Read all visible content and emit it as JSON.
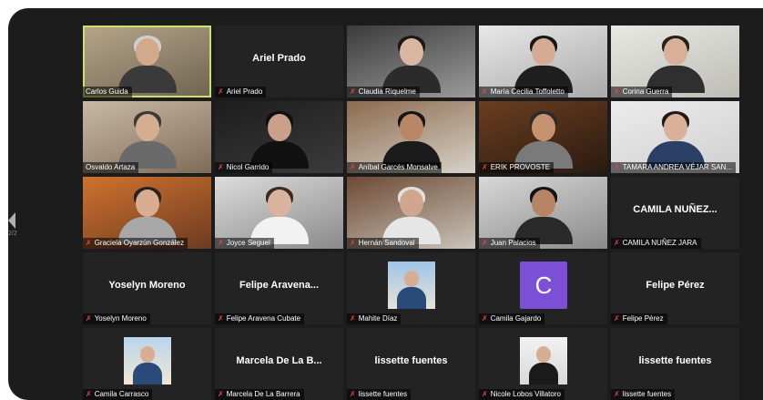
{
  "page": {
    "current": "2/2"
  },
  "colors": {
    "active_speaker": "#c9e36a",
    "muted_icon": "#e24646",
    "avatar_c": "#7b4fd6"
  },
  "participants": [
    {
      "name": "Carlos Guida",
      "display": "",
      "video": true,
      "muted": false,
      "active": true
    },
    {
      "name": "Ariel Prado",
      "display": "Ariel Prado",
      "video": false,
      "muted": true
    },
    {
      "name": "Claudia Riquelme",
      "display": "",
      "video": true,
      "muted": true
    },
    {
      "name": "María Cecilia Toffoletto",
      "display": "",
      "video": true,
      "muted": true
    },
    {
      "name": "Corina Guerra",
      "display": "",
      "video": true,
      "muted": true
    },
    {
      "name": "Osvaldo Artaza",
      "display": "",
      "video": true,
      "muted": false
    },
    {
      "name": "Nicol Garrido",
      "display": "",
      "video": true,
      "muted": true
    },
    {
      "name": "Aníbal Garcés Monsalve",
      "display": "",
      "video": true,
      "muted": true
    },
    {
      "name": "ERIK PROVOSTE",
      "display": "",
      "video": true,
      "muted": true
    },
    {
      "name": "TAMARA ANDREA VÉJAR SAN...",
      "display": "",
      "video": true,
      "muted": true
    },
    {
      "name": "Graciela Oyarzún González",
      "display": "",
      "video": true,
      "muted": true
    },
    {
      "name": "Joyce Seguel",
      "display": "",
      "video": true,
      "muted": true
    },
    {
      "name": "Hernán Sandoval",
      "display": "",
      "video": true,
      "muted": true
    },
    {
      "name": "Juan Palacios",
      "display": "",
      "video": true,
      "muted": true
    },
    {
      "name": "CAMILA NUÑEZ JARA",
      "display": "CAMILA NUÑEZ...",
      "video": false,
      "muted": true
    },
    {
      "name": "Yoselyn Moreno",
      "display": "Yoselyn Moreno",
      "video": false,
      "muted": true
    },
    {
      "name": "Felipe Aravena Cubate",
      "display": "Felipe Aravena...",
      "video": false,
      "muted": true
    },
    {
      "name": "Mahite Díaz",
      "display": "",
      "video": false,
      "muted": true,
      "photo": true
    },
    {
      "name": "Camila Gajardo",
      "display": "",
      "video": false,
      "muted": true,
      "avatar_letter": "C"
    },
    {
      "name": "Felipe Pérez",
      "display": "Felipe Pérez",
      "video": false,
      "muted": true
    },
    {
      "name": "Camila Carrasco",
      "display": "",
      "video": false,
      "muted": true,
      "photo": true
    },
    {
      "name": "Marcela De La Barrera",
      "display": "Marcela De La B...",
      "video": false,
      "muted": true
    },
    {
      "name": "lissette fuentes",
      "display": "lissette fuentes",
      "video": false,
      "muted": true
    },
    {
      "name": "Nicole Lobos Villatoro",
      "display": "",
      "video": false,
      "muted": true,
      "photo": true
    },
    {
      "name": "lissette fuentes",
      "display": "lissette fuentes",
      "video": false,
      "muted": true
    }
  ]
}
